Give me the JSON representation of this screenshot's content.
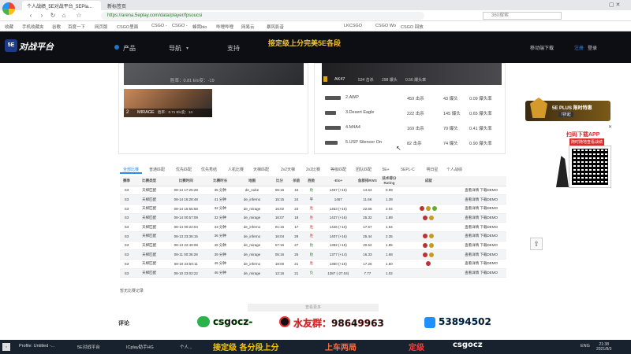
{
  "browser": {
    "tabs": [
      "个人战绩_5E对战平台_5EPla...",
      "新标签页"
    ],
    "url": "https://arena.5eplay.com/data/player/fpsoucsi",
    "search_placeholder": "360搜索",
    "bookmarks": [
      "收藏",
      "手机收藏夹",
      "谷歌",
      "百度一下",
      "网页版",
      "好游戏",
      "CSGO里面",
      "CSGO -",
      "CSGO -",
      "蜂窝bio",
      "哔哩哔哩",
      "优酷",
      "网易云",
      "暴风影音",
      "LKCSGO",
      "CSGO Wo",
      "CSGO 回放"
    ]
  },
  "site": {
    "logo": "对战平台",
    "nav": [
      "产品",
      "导航",
      "支持"
    ],
    "banner": "接定级上分完美5E各段",
    "buttons": [
      "移动端下载",
      "注册",
      "登录"
    ]
  },
  "maps": [
    {
      "num": "",
      "name": "",
      "stats": "胜率：0.81     Elo变：-19"
    },
    {
      "num": "2",
      "name": "MIRAGE",
      "stats": "胜率：0.71  Elo变：14"
    }
  ],
  "top_weapon": {
    "name": "AK47",
    "kills": "534 击杀",
    "hs": "298 爆头",
    "rate": "0.56 爆头率"
  },
  "weapons": [
    {
      "name": "2.AWP",
      "kills": "459 击杀",
      "hs": "43 爆头",
      "rate": "0.09 爆头率"
    },
    {
      "name": "3.Desert Eagle",
      "kills": "222 击杀",
      "hs": "145 爆头",
      "rate": "0.65 爆头率"
    },
    {
      "name": "4.M4A4",
      "kills": "169 击杀",
      "hs": "70 爆头",
      "rate": "0.41 爆头率"
    },
    {
      "name": "5.USP Silencer On",
      "kills": "82 击杀",
      "hs": "74 爆头",
      "rate": "0.90 爆头率"
    }
  ],
  "match_tabs": [
    "全部比赛",
    "普通匹配",
    "优先匹配",
    "优先秀结",
    "人机比赛",
    "天梯匹配",
    "2v2天梯",
    "2v2比赛",
    "等级匹配",
    "团队匹配",
    "5E+",
    "5EPL-C",
    "明日星",
    "个人战绩"
  ],
  "table": {
    "headers": [
      "赛季",
      "比赛类型",
      "比赛时间",
      "比赛时长",
      "地图",
      "比分",
      "杀敌",
      "胜败",
      "-Elo+",
      "鱼群排RWS",
      "技术得分Rating",
      "成就",
      ""
    ],
    "rows": [
      [
        "S3",
        "天梯匹配",
        "08-14 17:25:28",
        "35 分钟",
        "de_nuke",
        "06:16",
        "16",
        "败",
        "1467 (+16)",
        "14.64",
        "0.99",
        "",
        "查看详情 下载DEMO"
      ],
      [
        "S3",
        "天梯匹配",
        "08-14 16:28:48",
        "41 分钟",
        "de_inferno",
        "15:15",
        "24",
        "平",
        "1467",
        "11.66",
        "1.39",
        "",
        "查看详情 下载DEMO"
      ],
      [
        "S3",
        "天梯匹配",
        "08-14 15:55:58",
        "32 分钟",
        "de_mirage",
        "16:02",
        "23",
        "胜",
        "1453 (+16)",
        "22.66",
        "2.04",
        "3",
        "查看详情 下载DEMO"
      ],
      [
        "S3",
        "天梯匹配",
        "08-14 00:57:09",
        "32 分钟",
        "de_mirage",
        "16:07",
        "18",
        "胜",
        "1437 (+16)",
        "25.32",
        "1.89",
        "2",
        "查看详情 下载DEMO"
      ],
      [
        "S3",
        "天梯匹配",
        "08-14 00:22:04",
        "33 分钟",
        "de_inferno",
        "01:16",
        "17",
        "胜",
        "1426 (+10)",
        "17.67",
        "1.64",
        "",
        "查看详情 下载DEMO"
      ],
      [
        "S3",
        "天梯匹配",
        "08-13 23:36:15",
        "36 分钟",
        "de_inferno",
        "16:04",
        "29",
        "胜",
        "1407 (+16)",
        "25.44",
        "2.35",
        "2",
        "查看详情 下载DEMO"
      ],
      [
        "S3",
        "天梯匹配",
        "08-13 22:49:08",
        "45 分钟",
        "de_mirage",
        "07:16",
        "27",
        "败",
        "1392 (+15)",
        "20.62",
        "1.85",
        "2",
        "查看详情 下载DEMO"
      ],
      [
        "S3",
        "天梯匹配",
        "08-11 00:36:28",
        "39 分钟",
        "de_mirage",
        "05:16",
        "25",
        "败",
        "1377 (+14)",
        "16.33",
        "1.68",
        "2",
        "查看详情 下载DEMO"
      ],
      [
        "S3",
        "天梯匹配",
        "08-10 23:50:11",
        "45 分钟",
        "de_inferno",
        "18:00",
        "21",
        "胜",
        "1360 (+16)",
        "17.26",
        "1.50",
        "1",
        "查看详情 下载DEMO"
      ],
      [
        "S3",
        "天梯匹配",
        "08-10 23:02:22",
        "46 分钟",
        "de_mirage",
        "12:16",
        "21",
        "负",
        "1387 (-27.04)",
        "7.77",
        "1.02",
        "",
        "查看详情 下载DEMO"
      ]
    ]
  },
  "notes": {
    "abnormal": "暂无比赛记录",
    "load_more": "查看更多",
    "comments": "评论"
  },
  "sidebar_ad": {
    "title": "5E PLUS 限时特惠",
    "price": "7折起",
    "app_title": "扫码下载APP",
    "app_sub": "随时随地查看战绩"
  },
  "overlay": {
    "wechat": "csgocz-",
    "qq_group": "水友群：98649963",
    "qq": "53894502",
    "bottom1": "接定级 各分段上分",
    "bottom2": "上车两局",
    "bottom3": "定级",
    "bottom4": "csgocz"
  },
  "taskbar": {
    "items": [
      "Profile: Untitled -...",
      "5E对战平台",
      "ICplay助手HG",
      "个人..."
    ],
    "lang": "ENG",
    "time": "21:38",
    "date": "2021/8/3"
  },
  "colors": {
    "header_bg": "#0c0e14",
    "banner": "#f2c230",
    "win": "#e24b4b",
    "lose": "#2f8f2f",
    "link": "#aaaaaa"
  }
}
